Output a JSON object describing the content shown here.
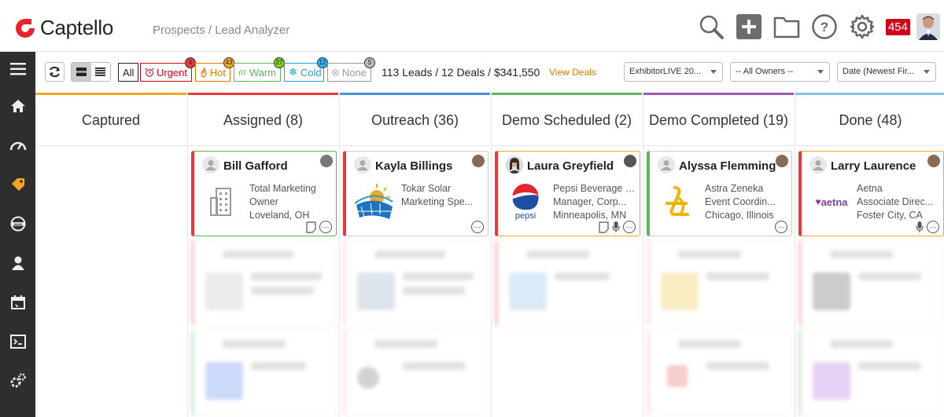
{
  "app": {
    "logo_text": "Captello",
    "breadcrumb": "Prospects / Lead Analyzer",
    "notification_count": "454"
  },
  "header_icons": [
    "search-icon",
    "add-icon",
    "folder-icon",
    "help-icon",
    "gear-icon"
  ],
  "sidebar": {
    "items": [
      "menu-icon",
      "home-icon",
      "dashboard-icon",
      "tag-icon",
      "web-icon",
      "user-icon",
      "calendar-icon",
      "console-icon",
      "settings-icon"
    ]
  },
  "toolbar": {
    "filters": [
      {
        "label": "All",
        "badge": ""
      },
      {
        "label": "Urgent",
        "badge": "4",
        "color": "#d0021b",
        "badge_bg": "#e8383d"
      },
      {
        "label": "Hot",
        "badge": "43",
        "color": "#e07b00",
        "badge_bg": "#f5a623"
      },
      {
        "label": "Warm",
        "badge": "27",
        "color": "#5cb85c",
        "badge_bg": "#7ed321"
      },
      {
        "label": "Cold",
        "badge": "12",
        "color": "#1aa1d6",
        "badge_bg": "#29b6f6"
      },
      {
        "label": "None",
        "badge": "5",
        "color": "#999999",
        "badge_bg": "#bbbbbb"
      }
    ],
    "stats": "113 Leads / 12 Deals / $341,550",
    "view_deals": "View Deals",
    "event_select": "ExhibitorLIVE 20...",
    "owner_select": "-- All Owners --",
    "sort_select": "Date (Newest Fir..."
  },
  "columns": [
    {
      "title": "Captured",
      "color": "#f5a623"
    },
    {
      "title": "Assigned (8)",
      "color": "#e8383d"
    },
    {
      "title": "Outreach (36)",
      "color": "#4a90d9"
    },
    {
      "title": "Demo Scheduled (2)",
      "color": "#5cb85c"
    },
    {
      "title": "Demo Completed (19)",
      "color": "#9b59b6"
    },
    {
      "title": "Done (48)",
      "color": "#7fc4e8"
    }
  ],
  "cards": {
    "assigned": {
      "name": "Bill Gafford",
      "line1": "Total Marketing",
      "line2": "Owner",
      "line3": "Loveland, OH",
      "logo": "building-icon"
    },
    "outreach": {
      "name": "Kayla Billings",
      "line1": "Tokar Solar",
      "line2": "Marketing Spe...",
      "line3": "",
      "logo": "solar-logo"
    },
    "demo_scheduled": {
      "name": "Laura Greyfield",
      "line1": "Pepsi Beverage Co.",
      "line2": "Manager, Corp...",
      "line3": "Minneapolis, MN",
      "logo": "pepsi-logo",
      "logo_text": "pepsi"
    },
    "demo_completed": {
      "name": "Alyssa Flemming",
      "line1": "Astra Zeneka",
      "line2": "Event Coordin...",
      "line3": "Chicago, Illinois",
      "logo": "astrazeneca-logo"
    },
    "done": {
      "name": "Larry Laurence",
      "line1": "Aetna",
      "line2": "Associate Direc...",
      "line3": "Foster City, CA",
      "logo": "aetna-logo",
      "logo_text": "aetna"
    }
  }
}
